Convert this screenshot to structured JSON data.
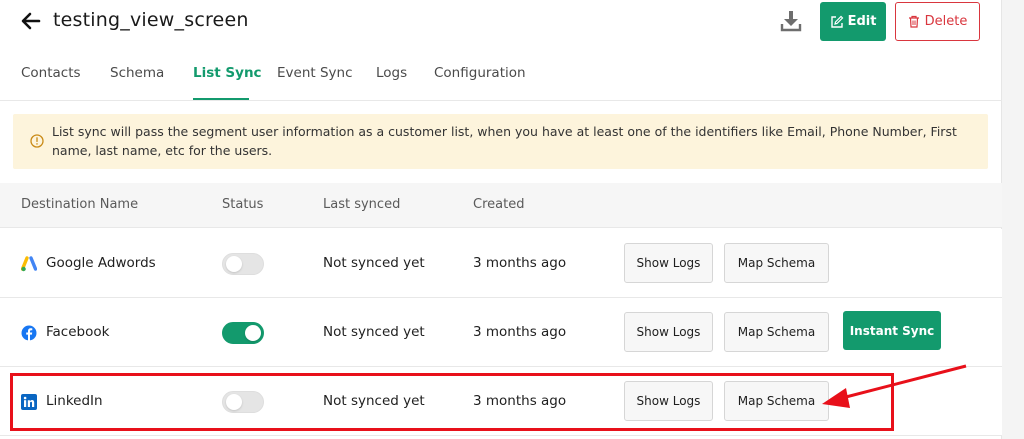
{
  "header": {
    "title": "testing_view_screen",
    "edit_label": "Edit",
    "delete_label": "Delete"
  },
  "tabs": [
    {
      "label": "Contacts"
    },
    {
      "label": "Schema"
    },
    {
      "label": "List Sync"
    },
    {
      "label": "Event Sync"
    },
    {
      "label": "Logs"
    },
    {
      "label": "Configuration"
    }
  ],
  "active_tab": "List Sync",
  "notice": {
    "text": "List sync will pass the segment user information as a customer list, when you have at least one of the identifiers like Email, Phone Number, First name, last name, etc for the users."
  },
  "table": {
    "columns": [
      "Destination Name",
      "Status",
      "Last synced",
      "Created"
    ],
    "rows": [
      {
        "name": "Google Adwords",
        "icon": "google-ads-icon",
        "status_on": false,
        "last_synced": "Not synced yet",
        "created": "3 months ago",
        "show_logs": "Show Logs",
        "map_schema": "Map Schema"
      },
      {
        "name": "Facebook",
        "icon": "facebook-icon",
        "status_on": true,
        "last_synced": "Not synced yet",
        "created": "3 months ago",
        "show_logs": "Show Logs",
        "map_schema": "Map Schema",
        "instant_sync": "Instant Sync"
      },
      {
        "name": "LinkedIn",
        "icon": "linkedin-icon",
        "status_on": false,
        "last_synced": "Not synced yet",
        "created": "3 months ago",
        "show_logs": "Show Logs",
        "map_schema": "Map Schema"
      }
    ]
  },
  "colors": {
    "accent": "#139a6d",
    "danger": "#d9363e",
    "notice_bg": "#fdf4dc",
    "annotation": "#e8101a"
  }
}
